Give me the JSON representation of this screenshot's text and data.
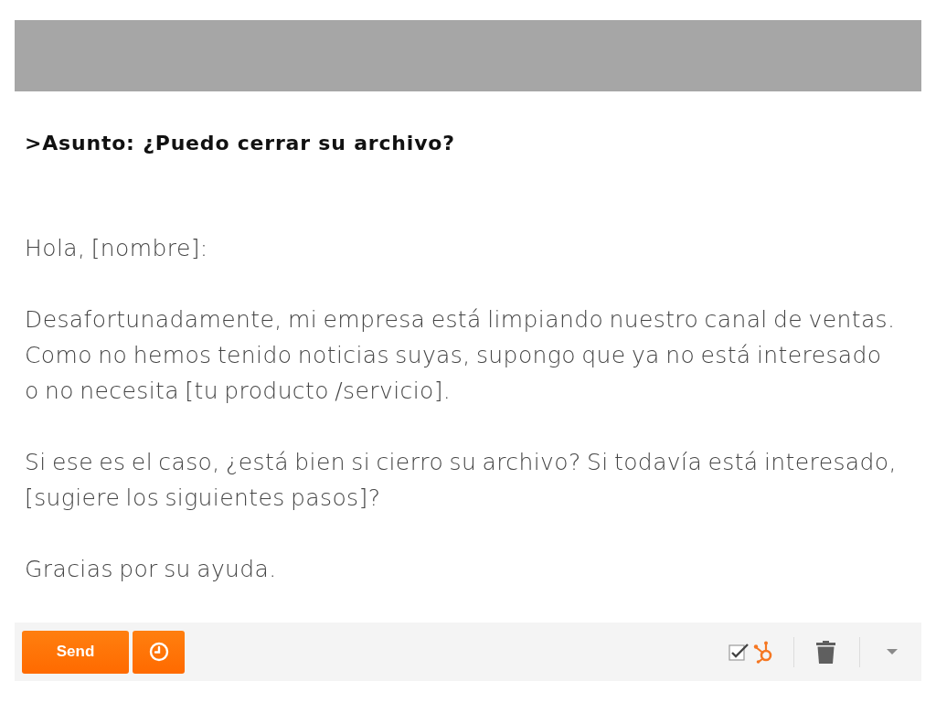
{
  "subject": ">Asunto: ¿Puedo cerrar su archivo?",
  "body": [
    "Hola, [nombre]:",
    "Desafortunadamente, mi empresa está limpiando nuestro canal de ventas. Como no hemos tenido noticias suyas, supongo que ya no está interesado o no necesita [tu producto /servicio].",
    "Si ese es el caso, ¿está bien si cierro su archivo? Si todavía está interesado, [sugiere los siguientes pasos]?",
    "Gracias por su ayuda."
  ],
  "toolbar": {
    "send_button": "Send",
    "tracking": {
      "checked": true
    }
  }
}
